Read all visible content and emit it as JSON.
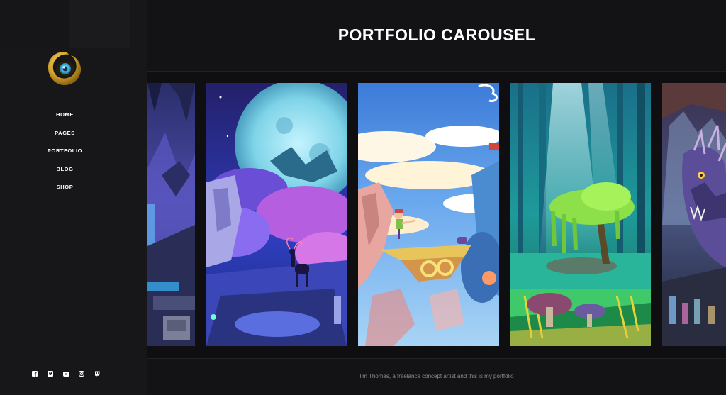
{
  "header": {
    "title": "PORTFOLIO CAROUSEL"
  },
  "nav": {
    "items": [
      {
        "label": "HOME"
      },
      {
        "label": "PAGES"
      },
      {
        "label": "PORTFOLIO"
      },
      {
        "label": "BLOG"
      },
      {
        "label": "SHOP"
      }
    ]
  },
  "social": {
    "icons": [
      "facebook-icon",
      "twitter-icon",
      "youtube-icon",
      "instagram-icon",
      "twitch-icon"
    ]
  },
  "carousel": {
    "cards": [
      {
        "name": "crystal-castle-art"
      },
      {
        "name": "moon-deer-art"
      },
      {
        "name": "sky-island-art"
      },
      {
        "name": "jungle-tree-art"
      },
      {
        "name": "dragon-art"
      }
    ]
  },
  "footer": {
    "text": "I'm Thomas, a freelance concept artist and this is my portfolio"
  },
  "colors": {
    "background": "#131316",
    "sidebar": "#17171a",
    "accent_gold": "#d4a62a",
    "accent_blue": "#3fb9e6"
  }
}
